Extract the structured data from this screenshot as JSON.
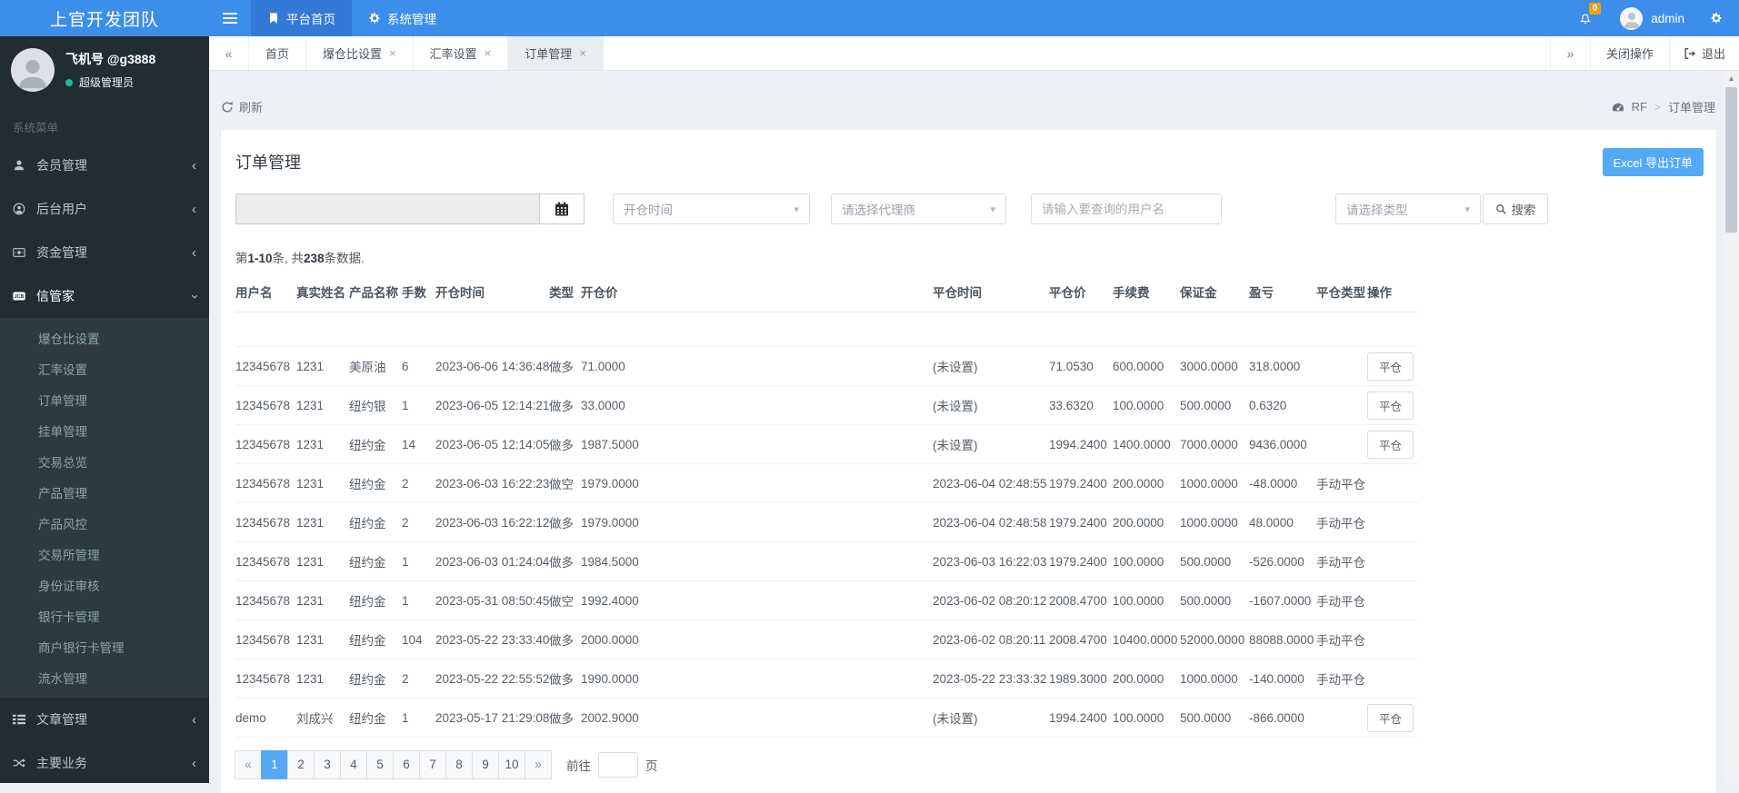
{
  "colors": {
    "navbar_blue": "#3d8eea",
    "navbar_active_blue": "#3279d8",
    "sidebar_dark": "#222d32",
    "submenu_dark": "#2c3b41",
    "accent_blue": "#54a8f5",
    "badge_orange": "#f39c12",
    "online_green": "#17bc9b",
    "content_bg": "#edf0f4"
  },
  "brand": {
    "title": "上官开发团队"
  },
  "navbar": {
    "items": [
      {
        "label": "平台首页",
        "icon": "bookmark-icon",
        "active": true
      },
      {
        "label": "系统管理",
        "icon": "gears-icon",
        "active": false
      }
    ],
    "notification_count": "0",
    "username": "admin"
  },
  "sidebar": {
    "user": {
      "name": "飞机号 @g3888",
      "role": "超级管理员"
    },
    "section_label": "系统菜单",
    "menu": [
      {
        "label": "会员管理",
        "icon": "user-icon",
        "expanded": false,
        "children": []
      },
      {
        "label": "后台用户",
        "icon": "user-circle-icon",
        "expanded": false,
        "children": []
      },
      {
        "label": "资金管理",
        "icon": "money-icon",
        "expanded": false,
        "children": []
      },
      {
        "label": "信管家",
        "icon": "credit-card-icon",
        "expanded": true,
        "children": [
          "爆仓比设置",
          "汇率设置",
          "订单管理",
          "挂单管理",
          "交易总览",
          "产品管理",
          "产品风控",
          "交易所管理",
          "身份证审核",
          "银行卡管理",
          "商户银行卡管理",
          "流水管理"
        ]
      },
      {
        "label": "文章管理",
        "icon": "list-icon",
        "expanded": false,
        "children": []
      },
      {
        "label": "主要业务",
        "icon": "shuffle-icon",
        "expanded": false,
        "children": []
      }
    ]
  },
  "tabbar": {
    "scroll_left": "«",
    "scroll_right": "»",
    "tabs": [
      {
        "label": "首页",
        "closable": false,
        "active": false
      },
      {
        "label": "爆仓比设置",
        "closable": true,
        "active": false
      },
      {
        "label": "汇率设置",
        "closable": true,
        "active": false
      },
      {
        "label": "订单管理",
        "closable": true,
        "active": true
      }
    ],
    "close_operations": "关闭操作",
    "logout": "退出"
  },
  "toolbar": {
    "refresh_label": "刷新"
  },
  "breadcrumb": {
    "root": "RF",
    "separator": ">",
    "current": "订单管理"
  },
  "panel": {
    "title": "订单管理",
    "export_button": "Excel 导出订单",
    "filters": {
      "date_range_value": "",
      "open_time_select": "开仓时间",
      "agent_select": "请选择代理商",
      "username_placeholder": "请输入要查询的用户名",
      "type_select": "请选择类型",
      "search_label": "搜索"
    },
    "stats": {
      "prefix": "第",
      "range": "1-10",
      "mid": "条, 共",
      "total": "238",
      "suffix": "条数据."
    },
    "table": {
      "columns": [
        "用户名",
        "真实姓名",
        "产品名称",
        "手数",
        "开仓时间",
        "类型",
        "开仓价",
        "平仓时间",
        "平仓价",
        "手续费",
        "保证金",
        "盈亏",
        "平仓类型",
        "操作"
      ],
      "close_button_label": "平仓",
      "rows": [
        {
          "cells": [
            "12345678",
            "1231",
            "美原油",
            "6",
            "2023-06-06 14:36:48",
            "做多",
            "71.0000",
            "(未设置)",
            "71.0530",
            "600.0000",
            "3000.0000",
            "318.0000",
            ""
          ],
          "can_close": true
        },
        {
          "cells": [
            "12345678",
            "1231",
            "纽约银",
            "1",
            "2023-06-05 12:14:21",
            "做多",
            "33.0000",
            "(未设置)",
            "33.6320",
            "100.0000",
            "500.0000",
            "0.6320",
            ""
          ],
          "can_close": true
        },
        {
          "cells": [
            "12345678",
            "1231",
            "纽约金",
            "14",
            "2023-06-05 12:14:05",
            "做多",
            "1987.5000",
            "(未设置)",
            "1994.2400",
            "1400.0000",
            "7000.0000",
            "9436.0000",
            ""
          ],
          "can_close": true
        },
        {
          "cells": [
            "12345678",
            "1231",
            "纽约金",
            "2",
            "2023-06-03 16:22:23",
            "做空",
            "1979.0000",
            "2023-06-04 02:48:55",
            "1979.2400",
            "200.0000",
            "1000.0000",
            "-48.0000",
            "手动平仓"
          ],
          "can_close": false
        },
        {
          "cells": [
            "12345678",
            "1231",
            "纽约金",
            "2",
            "2023-06-03 16:22:12",
            "做多",
            "1979.0000",
            "2023-06-04 02:48:58",
            "1979.2400",
            "200.0000",
            "1000.0000",
            "48.0000",
            "手动平仓"
          ],
          "can_close": false
        },
        {
          "cells": [
            "12345678",
            "1231",
            "纽约金",
            "1",
            "2023-06-03 01:24:04",
            "做多",
            "1984.5000",
            "2023-06-03 16:22:03",
            "1979.2400",
            "100.0000",
            "500.0000",
            "-526.0000",
            "手动平仓"
          ],
          "can_close": false
        },
        {
          "cells": [
            "12345678",
            "1231",
            "纽约金",
            "1",
            "2023-05-31 08:50:45",
            "做空",
            "1992.4000",
            "2023-06-02 08:20:12",
            "2008.4700",
            "100.0000",
            "500.0000",
            "-1607.0000",
            "手动平仓"
          ],
          "can_close": false
        },
        {
          "cells": [
            "12345678",
            "1231",
            "纽约金",
            "104",
            "2023-05-22 23:33:40",
            "做多",
            "2000.0000",
            "2023-06-02 08:20:11",
            "2008.4700",
            "10400.0000",
            "52000.0000",
            "88088.0000",
            "手动平仓"
          ],
          "can_close": false
        },
        {
          "cells": [
            "12345678",
            "1231",
            "纽约金",
            "2",
            "2023-05-22 22:55:52",
            "做多",
            "1990.0000",
            "2023-05-22 23:33:32",
            "1989.3000",
            "200.0000",
            "1000.0000",
            "-140.0000",
            "手动平仓"
          ],
          "can_close": false
        },
        {
          "cells": [
            "demo",
            "刘成兴",
            "纽约金",
            "1",
            "2023-05-17 21:29:08",
            "做多",
            "2002.9000",
            "(未设置)",
            "1994.2400",
            "100.0000",
            "500.0000",
            "-866.0000",
            ""
          ],
          "can_close": true
        }
      ]
    },
    "pagination": {
      "prev": "«",
      "next": "»",
      "pages": [
        "1",
        "2",
        "3",
        "4",
        "5",
        "6",
        "7",
        "8",
        "9",
        "10"
      ],
      "active_page": "1",
      "goto_label": "前往",
      "goto_suffix": "页"
    }
  }
}
